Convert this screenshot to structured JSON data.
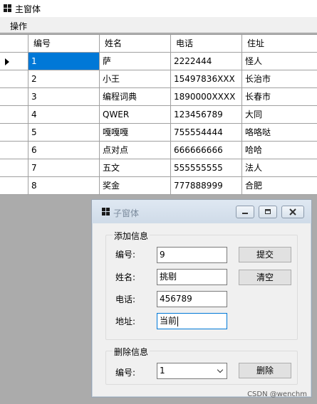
{
  "main_window": {
    "title": "主窗体",
    "menu": [
      "操作"
    ]
  },
  "grid": {
    "columns": [
      "编号",
      "姓名",
      "电话",
      "住址"
    ],
    "rows": [
      [
        "1",
        "萨",
        "2222444",
        "怪人"
      ],
      [
        "2",
        "小王",
        "15497836XXX",
        "长治市"
      ],
      [
        "3",
        "编程词典",
        "1890000XXXX",
        "长春市"
      ],
      [
        "4",
        "QWER",
        "123456789",
        "大同"
      ],
      [
        "5",
        "嘎嘎嘎",
        "755554444",
        "咯咯哒"
      ],
      [
        "6",
        "点对点",
        "666666666",
        "哈哈"
      ],
      [
        "7",
        "五文",
        "555555555",
        "法人"
      ],
      [
        "8",
        "奖金",
        "777888999",
        "合肥"
      ]
    ],
    "selected_row": 0
  },
  "child_window": {
    "title": "子窗体",
    "add_group": {
      "legend": "添加信息",
      "id_label": "编号:",
      "id_value": "9",
      "name_label": "姓名:",
      "name_value": "挑剔",
      "phone_label": "电话:",
      "phone_value": "456789",
      "addr_label": "地址:",
      "addr_value": "当前",
      "submit_label": "提交",
      "clear_label": "清空"
    },
    "delete_group": {
      "legend": "删除信息",
      "id_label": "编号:",
      "id_selected": "1",
      "delete_label": "删除"
    }
  },
  "watermark": "CSDN @wenchm",
  "colors": {
    "selection": "#0078d7",
    "background": "#ababab"
  }
}
